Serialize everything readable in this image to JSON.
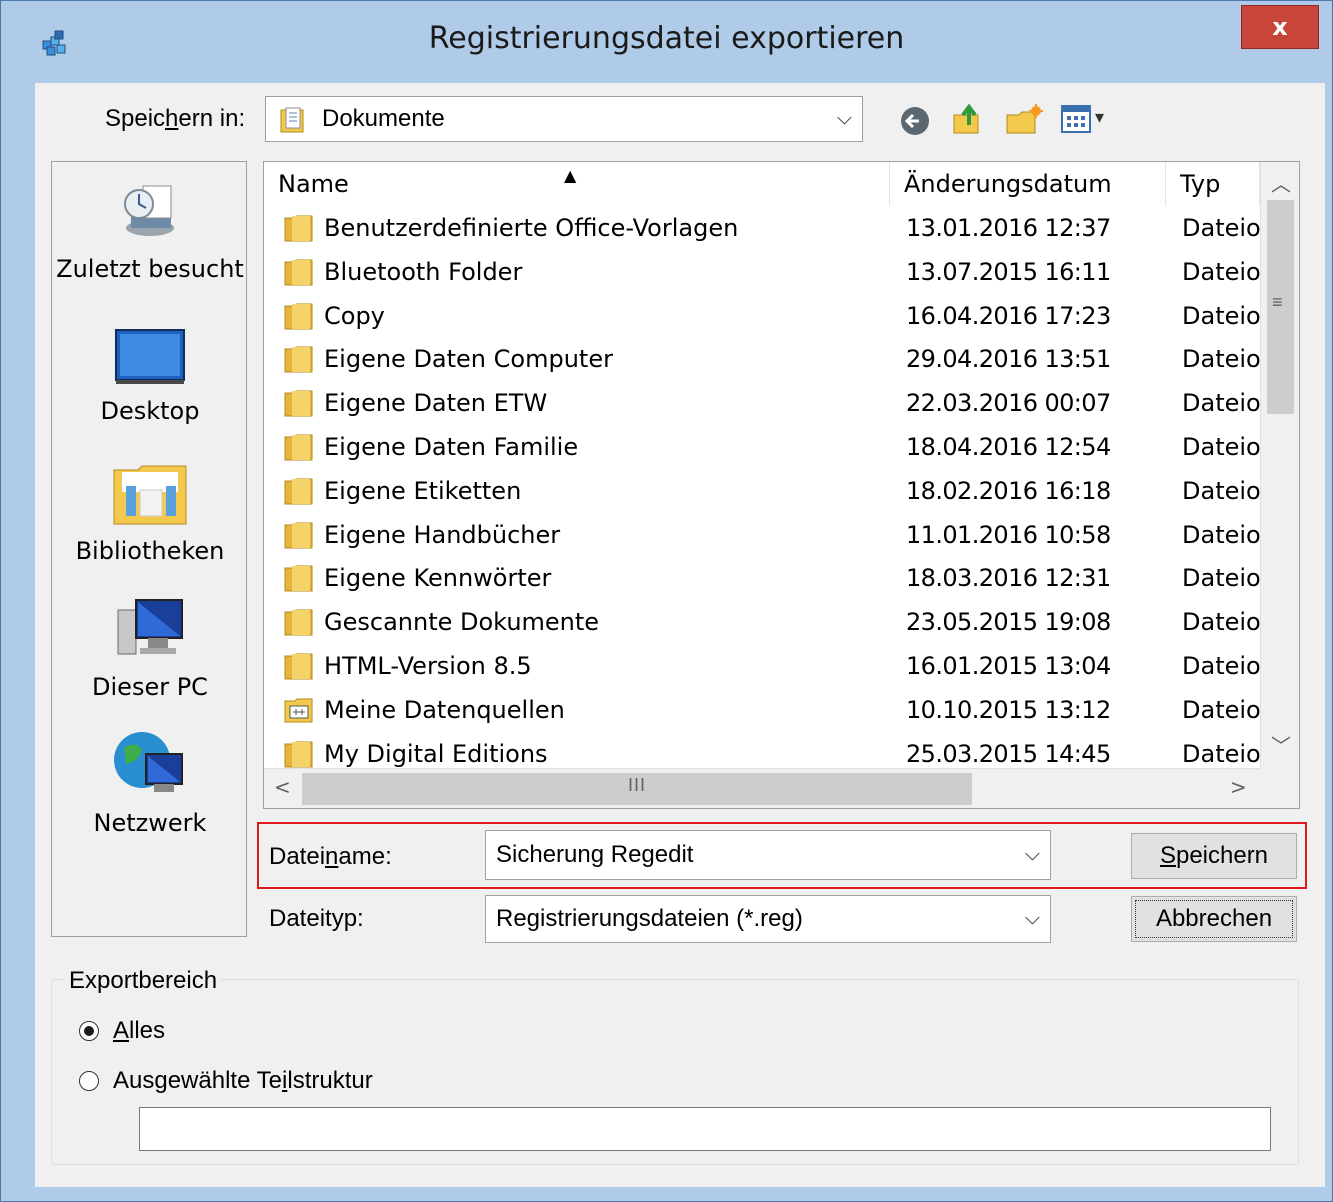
{
  "window": {
    "title": "Registrierungsdatei exportieren",
    "close_label": "x"
  },
  "save_in": {
    "label_pre": "Speic",
    "label_accel": "h",
    "label_post": "ern in:",
    "value": "Dokumente"
  },
  "toolbar": {
    "back_icon": "back-arrow-icon",
    "up_icon": "up-folder-icon",
    "new_folder_icon": "new-folder-icon",
    "view_icon": "view-menu-icon"
  },
  "places": [
    {
      "label": "Zuletzt besucht",
      "icon": "recent-places-icon"
    },
    {
      "label": "Desktop",
      "icon": "desktop-icon"
    },
    {
      "label": "Bibliotheken",
      "icon": "libraries-icon"
    },
    {
      "label": "Dieser PC",
      "icon": "this-pc-icon"
    },
    {
      "label": "Netzwerk",
      "icon": "network-icon"
    }
  ],
  "columns": {
    "name": "Name",
    "date": "Änderungsdatum",
    "type": "Typ"
  },
  "files": [
    {
      "name": "Benutzerdefinierte Office-Vorlagen",
      "date": "13.01.2016 12:37",
      "type": "Dateio"
    },
    {
      "name": "Bluetooth Folder",
      "date": "13.07.2015 16:11",
      "type": "Dateio"
    },
    {
      "name": "Copy",
      "date": "16.04.2016 17:23",
      "type": "Dateio"
    },
    {
      "name": "Eigene Daten Computer",
      "date": "29.04.2016 13:51",
      "type": "Dateio"
    },
    {
      "name": "Eigene Daten ETW",
      "date": "22.03.2016 00:07",
      "type": "Dateio"
    },
    {
      "name": "Eigene Daten Familie",
      "date": "18.04.2016 12:54",
      "type": "Dateio"
    },
    {
      "name": "Eigene Etiketten",
      "date": "18.02.2016 16:18",
      "type": "Dateio"
    },
    {
      "name": "Eigene Handbücher",
      "date": "11.01.2016 10:58",
      "type": "Dateio"
    },
    {
      "name": "Eigene Kennwörter",
      "date": "18.03.2016 12:31",
      "type": "Dateio"
    },
    {
      "name": "Gescannte Dokumente",
      "date": "23.05.2015 19:08",
      "type": "Dateio"
    },
    {
      "name": "HTML-Version 8.5",
      "date": "16.01.2015 13:04",
      "type": "Dateio"
    },
    {
      "name": "Meine Datenquellen",
      "date": "10.10.2015 13:12",
      "type": "Dateio"
    },
    {
      "name": "My Digital Editions",
      "date": "25.03.2015 14:45",
      "type": "Dateio"
    }
  ],
  "filename": {
    "label_pre": "Datei",
    "label_accel": "n",
    "label_post": "ame:",
    "value": "Sicherung Regedit"
  },
  "filetype": {
    "label": "Dateityp:",
    "value": "Registrierungsdateien (*.reg)"
  },
  "buttons": {
    "save_accel": "S",
    "save_rest": "peichern",
    "cancel": "Abbrechen"
  },
  "export_range": {
    "legend": "Exportbereich",
    "all_accel": "A",
    "all_rest": "lles",
    "all_selected": true,
    "branch_pre": "Ausgewählte Te",
    "branch_accel": "i",
    "branch_post": "lstruktur",
    "branch_value": ""
  },
  "colors": {
    "title_bar": "#afcbe7",
    "close_button": "#c8453a",
    "highlight_box": "#e0191e",
    "folder_yellow": "#f2c94c"
  }
}
